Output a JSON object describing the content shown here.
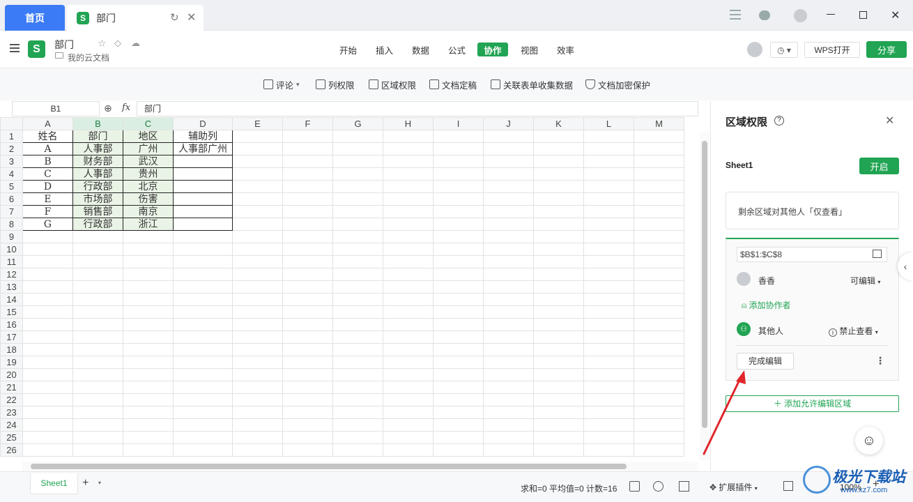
{
  "titlebar": {
    "home_tab": "首页",
    "doc_tab": "部门",
    "logo_letter": "S"
  },
  "header": {
    "doc_name": "部门",
    "location": "我的云文档",
    "menu_tabs": [
      "开始",
      "插入",
      "数据",
      "公式",
      "协作",
      "视图",
      "效率"
    ],
    "active_tab": "协作",
    "open_wps": "WPS打开",
    "share": "分享"
  },
  "collab_toolbar": [
    "评论",
    "列权限",
    "区域权限",
    "文档定稿",
    "关联表单收集数据",
    "文档加密保护"
  ],
  "formula_bar": {
    "cell_ref": "B1",
    "fx": "fx",
    "content": "部门"
  },
  "sheet": {
    "columns": [
      "A",
      "B",
      "C",
      "D",
      "E",
      "F",
      "G",
      "H",
      "I",
      "J",
      "K",
      "L",
      "M"
    ],
    "rows": [
      [
        "姓名",
        "部门",
        "地区",
        "辅助列"
      ],
      [
        "A",
        "人事部",
        "广州",
        "人事部广州"
      ],
      [
        "B",
        "财务部",
        "武汉",
        ""
      ],
      [
        "C",
        "人事部",
        "贵州",
        ""
      ],
      [
        "D",
        "行政部",
        "北京",
        ""
      ],
      [
        "E",
        "市场部",
        "伤害",
        ""
      ],
      [
        "F",
        "销售部",
        "南京",
        ""
      ],
      [
        "G",
        "行政部",
        "浙江",
        ""
      ]
    ],
    "row_count": 26
  },
  "panel": {
    "title": "区域权限",
    "sheet_name": "Sheet1",
    "enable_label": "开启",
    "remaining_note": "剩余区域对其他人「仅查看」",
    "range": "$B$1:$C$8",
    "user_name": "香香",
    "user_perm": "可编辑",
    "add_collaborator": "添加协作者",
    "others_label": "其他人",
    "others_perm": "禁止查看",
    "finish_edit": "完成编辑",
    "add_region": "添加允许编辑区域"
  },
  "statusbar": {
    "sheet_tab": "Sheet1",
    "stats": "求和=0  平均值=0  计数=16",
    "plugins": "扩展插件",
    "zoom": "100%"
  },
  "watermark": {
    "brand": "极光下载站",
    "url": "www.xz7.com"
  },
  "colors": {
    "accent": "#21a453",
    "home_tab": "#3c7bf6",
    "arrow": "#e0262b"
  }
}
